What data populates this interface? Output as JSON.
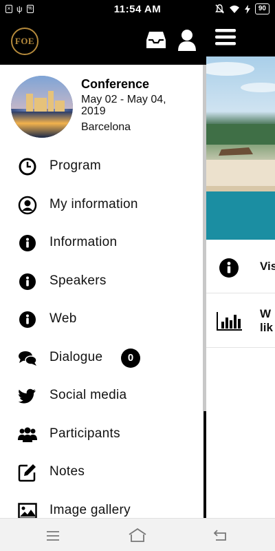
{
  "status_bar": {
    "time": "11:54 AM",
    "battery": "90",
    "left_icons": [
      "close-box-icon",
      "usb-icon",
      "nfc-icon"
    ],
    "right_icons": [
      "silent-icon",
      "wifi-icon",
      "charging-icon"
    ]
  },
  "app_header": {
    "logo_text": "FOE",
    "icons": [
      "inbox-icon",
      "user-icon",
      "menu-icon"
    ]
  },
  "conference": {
    "title": "Conference",
    "dates": "May 02 - May 04, 2019",
    "city": "Barcelona"
  },
  "menu": [
    {
      "label": "Program",
      "icon": "clock-icon"
    },
    {
      "label": "My information",
      "icon": "user-circle-icon"
    },
    {
      "label": "Information",
      "icon": "info-icon"
    },
    {
      "label": "Speakers",
      "icon": "info-icon"
    },
    {
      "label": "Web",
      "icon": "info-icon"
    },
    {
      "label": "Dialogue",
      "icon": "chat-icon",
      "badge": "0"
    },
    {
      "label": "Social media",
      "icon": "twitter-icon"
    },
    {
      "label": "Participants",
      "icon": "users-icon"
    },
    {
      "label": "Notes",
      "icon": "edit-icon"
    },
    {
      "label": "Image gallery",
      "icon": "image-icon"
    }
  ],
  "background": {
    "rows": [
      {
        "text": "Vis",
        "icon": "info-icon"
      },
      {
        "text_line1": "W",
        "text_line2": "lik",
        "icon": "bar-chart-icon"
      }
    ]
  },
  "colors": {
    "header_bg": "#000000",
    "logo_gold": "#b58a3c",
    "drawer_bg": "#ffffff",
    "badge_bg": "#000000"
  }
}
